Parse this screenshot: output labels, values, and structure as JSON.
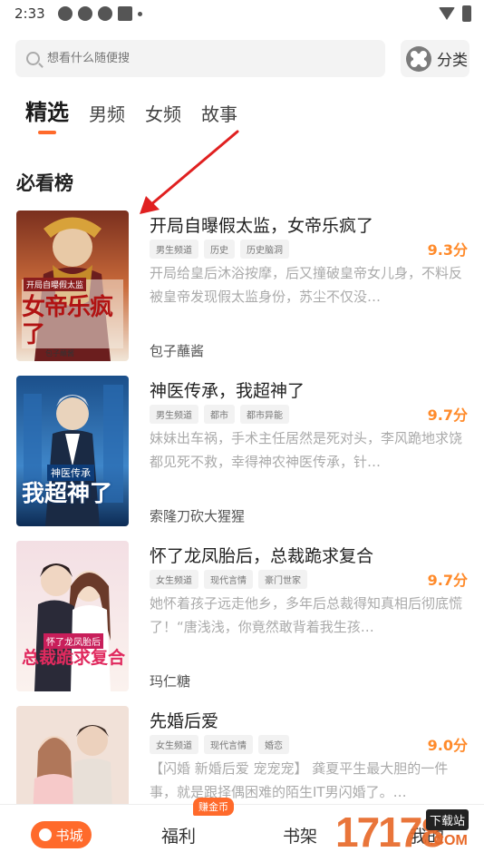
{
  "status_bar": {
    "time": "2:33"
  },
  "search": {
    "placeholder": "想看什么随便搜"
  },
  "category_button": {
    "label": "分类"
  },
  "tabs": [
    {
      "label": "精选",
      "active": true
    },
    {
      "label": "男频"
    },
    {
      "label": "女频"
    },
    {
      "label": "故事"
    }
  ],
  "section": {
    "title": "必看榜"
  },
  "books": [
    {
      "title": "开局自曝假太监，女帝乐疯了",
      "tags": [
        "男生频道",
        "历史",
        "历史脑洞"
      ],
      "score": "9.3分",
      "desc": "开局给皇后沐浴按摩，后又撞破皇帝女儿身，不料反被皇帝发现假太监身份，苏尘不仅没…",
      "author": "包子蘸酱",
      "cover_title": "女帝乐疯了",
      "cover_sub": "开局自曝假太监"
    },
    {
      "title": "神医传承，我超神了",
      "tags": [
        "男生频道",
        "都市",
        "都市异能"
      ],
      "score": "9.7分",
      "desc": "妹妹出车祸，手术主任居然是死对头，李风跪地求饶都见死不救，幸得神农神医传承，针…",
      "author": "索隆刀砍大猩猩",
      "cover_title": "我超神了",
      "cover_sub": "神医传承"
    },
    {
      "title": "怀了龙凤胎后，总裁跪求复合",
      "tags": [
        "女生频道",
        "现代言情",
        "豪门世家"
      ],
      "score": "9.7分",
      "desc": "她怀着孩子远走他乡，多年后总裁得知真相后彻底慌了！“唐浅浅，你竟然敢背着我生孩…",
      "author": "玛仁糖",
      "cover_title": "总裁跪求复合",
      "cover_sub": "怀了龙凤胎后"
    },
    {
      "title": "先婚后爱",
      "tags": [
        "女生频道",
        "现代言情",
        "婚恋"
      ],
      "score": "9.0分",
      "desc": "【闪婚 新婚后爱 宠宠宠】 龚夏平生最大胆的一件事，就是跟择偶困难的陌生IT男闪婚了。…",
      "author": "",
      "cover_title": "",
      "cover_sub": ""
    }
  ],
  "bottom_nav": {
    "home": "书城",
    "welfare": "福利",
    "welfare_badge": "赚金币",
    "shelf": "书架",
    "mine": "我的"
  },
  "watermark": {
    "number": "17178",
    "tag": "下载站",
    "domain": ".COM"
  },
  "colors": {
    "accent": "#ff6a2b",
    "score": "#ff8a2a",
    "arrow": "#e02020"
  }
}
